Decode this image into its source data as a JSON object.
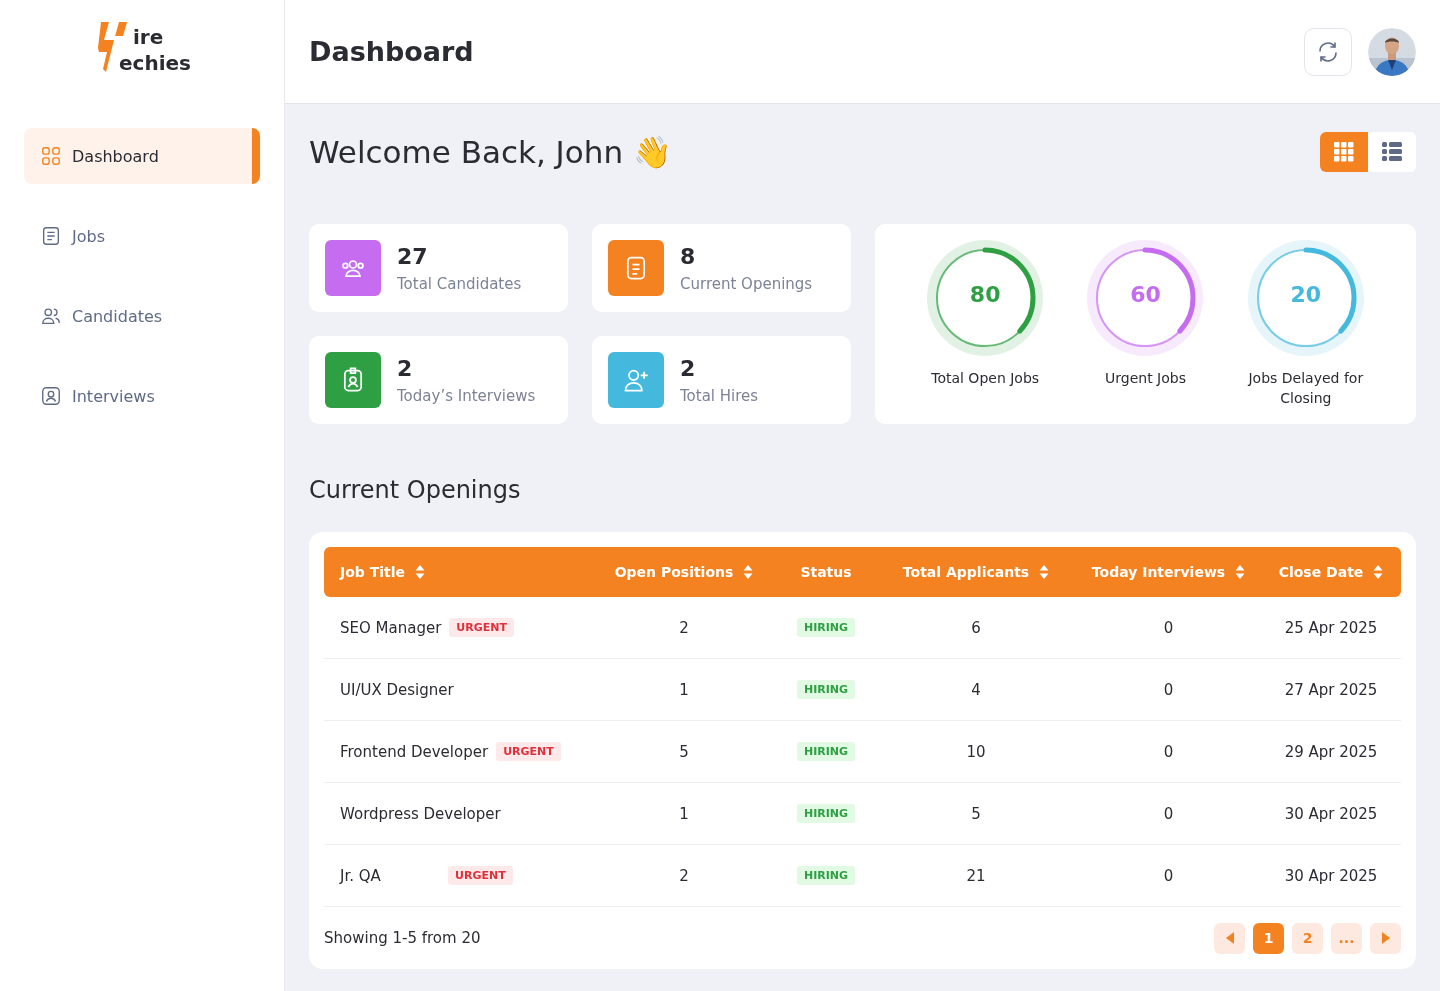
{
  "logo": {
    "line_1": "ire",
    "line_2": "echies"
  },
  "sidebar": {
    "items": [
      {
        "label": "Dashboard",
        "kind": "grid",
        "selected": true
      },
      {
        "label": "Jobs",
        "kind": "document",
        "selected": false
      },
      {
        "label": "Candidates",
        "kind": "users",
        "selected": false
      },
      {
        "label": "Interviews",
        "kind": "badge",
        "selected": false
      }
    ]
  },
  "header": {
    "title": "Dashboard"
  },
  "welcome": {
    "text": "Welcome Back, John",
    "emoji": "👋"
  },
  "view_toggle": [
    {
      "kind": "grid",
      "selected": true
    },
    {
      "kind": "list",
      "selected": false
    }
  ],
  "stats": [
    {
      "value": "27",
      "label": "Total Candidates",
      "kind": "users",
      "color": "#c56cf0"
    },
    {
      "value": "8",
      "label": "Current Openings",
      "kind": "document",
      "color": "#f58220"
    },
    {
      "value": "2",
      "label": "Today’s Interviews",
      "kind": "badge",
      "color": "#2ea043"
    },
    {
      "value": "2",
      "label": "Total Hires",
      "kind": "adduser",
      "color": "#45b9dd"
    }
  ],
  "gauges": [
    {
      "value": "80",
      "label": "Total Open Jobs",
      "level": 0.37,
      "color": "#2ea043"
    },
    {
      "value": "60",
      "label": "Urgent Jobs",
      "level": 0.37,
      "color": "#c56cf0"
    },
    {
      "value": "20",
      "label": "Jobs Delayed for Closing",
      "level": 0.37,
      "color": "#45b9dd"
    }
  ],
  "openings": {
    "title": "Current Openings",
    "columns": [
      {
        "label": "Job Title",
        "sortable": true
      },
      {
        "label": "Open Positions",
        "sortable": true
      },
      {
        "label": "Status",
        "sortable": false
      },
      {
        "label": "Total Applicants",
        "sortable": true
      },
      {
        "label": "Today Interviews",
        "sortable": true
      },
      {
        "label": "Close Date",
        "sortable": true
      }
    ],
    "rows": [
      {
        "title": "SEO Manager",
        "tag": "URGENT",
        "positions": "2",
        "status": "HIRING",
        "applicants": "6",
        "interviews": "0",
        "close": "25 Apr 2025"
      },
      {
        "title": "UI/UX Designer",
        "positions": "1",
        "status": "HIRING",
        "applicants": "4",
        "interviews": "0",
        "close": "27 Apr 2025"
      },
      {
        "title": "Frontend Developer",
        "tag": "URGENT",
        "positions": "5",
        "status": "HIRING",
        "applicants": "10",
        "interviews": "0",
        "close": "29 Apr 2025"
      },
      {
        "title": "Wordpress Developer",
        "positions": "1",
        "status": "HIRING",
        "applicants": "5",
        "interviews": "0",
        "close": "30 Apr 2025"
      },
      {
        "title": "Jr. QA",
        "tag": "URGENT",
        "positions": "2",
        "status": "HIRING",
        "applicants": "21",
        "interviews": "0",
        "close": "30 Apr 2025"
      }
    ],
    "summary": "Showing 1-5 from 20",
    "pages": [
      {
        "label": "1",
        "selected": true
      },
      {
        "label": "2",
        "selected": false
      },
      {
        "label": "...",
        "selected": false
      }
    ]
  }
}
